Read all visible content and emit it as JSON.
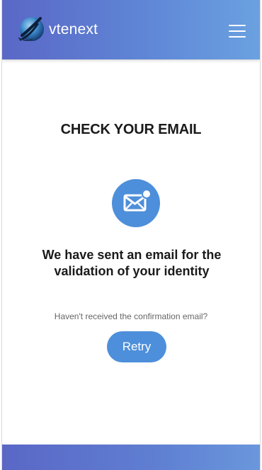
{
  "header": {
    "brand": "vtenext",
    "logo_icon": "globe-logo-icon",
    "menu_icon": "hamburger-menu-icon"
  },
  "main": {
    "title": "CHECK YOUR EMAIL",
    "icon": "envelope-notification-icon",
    "message": "We have sent an email for the validation of your identity",
    "hint": "Haven't received the confirmation email?",
    "retry_label": "Retry"
  },
  "colors": {
    "accent": "#4d8fda",
    "header_start": "#5a67c6",
    "header_end": "#6aa1e0"
  }
}
